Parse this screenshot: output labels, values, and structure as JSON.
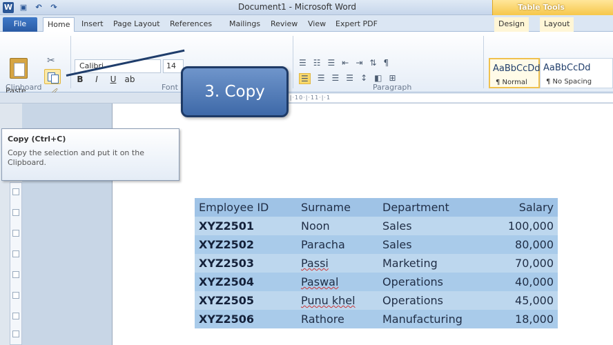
{
  "window": {
    "title": "Document1 - Microsoft Word",
    "table_tools": "Table Tools"
  },
  "tabs": [
    "File",
    "Home",
    "Insert",
    "Page Layout",
    "References",
    "Mailings",
    "Review",
    "View",
    "Expert PDF",
    "Design",
    "Layout"
  ],
  "ribbon": {
    "paste": "Paste",
    "font_name": "Calibri",
    "font_size": "14",
    "groups": {
      "clipboard": "Clipboard",
      "font": "Font",
      "paragraph": "Paragraph"
    },
    "styles": [
      {
        "sample": "AaBbCcDd",
        "name": "¶ Normal"
      },
      {
        "sample": "AaBbCcDd",
        "name": "¶ No Spacing"
      }
    ]
  },
  "callout": "3. Copy",
  "tooltip": {
    "title": "Copy (Ctrl+C)",
    "description": "Copy the selection and put it on the Clipboard."
  },
  "ruler": "·1·|·1·2·|·3·|·4·|·5·|·6·|·7·|·8·|·9·|·10·|·11·|·1",
  "table": {
    "headers": [
      "Employee ID",
      "Surname",
      "Department",
      "Salary"
    ],
    "rows": [
      [
        "XYZ2501",
        "Noon",
        "Sales",
        "100,000"
      ],
      [
        "XYZ2502",
        "Paracha",
        "Sales",
        "80,000"
      ],
      [
        "XYZ2503",
        "Passi",
        "Marketing",
        "70,000"
      ],
      [
        "XYZ2504",
        "Paswal",
        "Operations",
        "40,000"
      ],
      [
        "XYZ2505",
        "Punu khel",
        "Operations",
        "45,000"
      ],
      [
        "XYZ2506",
        "Rathore",
        "Manufacturing",
        "18,000"
      ]
    ]
  }
}
